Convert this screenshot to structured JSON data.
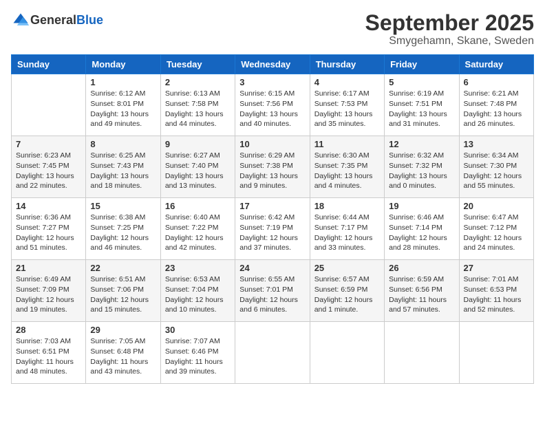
{
  "header": {
    "logo_general": "General",
    "logo_blue": "Blue",
    "month": "September 2025",
    "location": "Smygehamn, Skane, Sweden"
  },
  "weekdays": [
    "Sunday",
    "Monday",
    "Tuesday",
    "Wednesday",
    "Thursday",
    "Friday",
    "Saturday"
  ],
  "weeks": [
    [
      {
        "day": "",
        "info": ""
      },
      {
        "day": "1",
        "info": "Sunrise: 6:12 AM\nSunset: 8:01 PM\nDaylight: 13 hours\nand 49 minutes."
      },
      {
        "day": "2",
        "info": "Sunrise: 6:13 AM\nSunset: 7:58 PM\nDaylight: 13 hours\nand 44 minutes."
      },
      {
        "day": "3",
        "info": "Sunrise: 6:15 AM\nSunset: 7:56 PM\nDaylight: 13 hours\nand 40 minutes."
      },
      {
        "day": "4",
        "info": "Sunrise: 6:17 AM\nSunset: 7:53 PM\nDaylight: 13 hours\nand 35 minutes."
      },
      {
        "day": "5",
        "info": "Sunrise: 6:19 AM\nSunset: 7:51 PM\nDaylight: 13 hours\nand 31 minutes."
      },
      {
        "day": "6",
        "info": "Sunrise: 6:21 AM\nSunset: 7:48 PM\nDaylight: 13 hours\nand 26 minutes."
      }
    ],
    [
      {
        "day": "7",
        "info": "Sunrise: 6:23 AM\nSunset: 7:45 PM\nDaylight: 13 hours\nand 22 minutes."
      },
      {
        "day": "8",
        "info": "Sunrise: 6:25 AM\nSunset: 7:43 PM\nDaylight: 13 hours\nand 18 minutes."
      },
      {
        "day": "9",
        "info": "Sunrise: 6:27 AM\nSunset: 7:40 PM\nDaylight: 13 hours\nand 13 minutes."
      },
      {
        "day": "10",
        "info": "Sunrise: 6:29 AM\nSunset: 7:38 PM\nDaylight: 13 hours\nand 9 minutes."
      },
      {
        "day": "11",
        "info": "Sunrise: 6:30 AM\nSunset: 7:35 PM\nDaylight: 13 hours\nand 4 minutes."
      },
      {
        "day": "12",
        "info": "Sunrise: 6:32 AM\nSunset: 7:32 PM\nDaylight: 13 hours\nand 0 minutes."
      },
      {
        "day": "13",
        "info": "Sunrise: 6:34 AM\nSunset: 7:30 PM\nDaylight: 12 hours\nand 55 minutes."
      }
    ],
    [
      {
        "day": "14",
        "info": "Sunrise: 6:36 AM\nSunset: 7:27 PM\nDaylight: 12 hours\nand 51 minutes."
      },
      {
        "day": "15",
        "info": "Sunrise: 6:38 AM\nSunset: 7:25 PM\nDaylight: 12 hours\nand 46 minutes."
      },
      {
        "day": "16",
        "info": "Sunrise: 6:40 AM\nSunset: 7:22 PM\nDaylight: 12 hours\nand 42 minutes."
      },
      {
        "day": "17",
        "info": "Sunrise: 6:42 AM\nSunset: 7:19 PM\nDaylight: 12 hours\nand 37 minutes."
      },
      {
        "day": "18",
        "info": "Sunrise: 6:44 AM\nSunset: 7:17 PM\nDaylight: 12 hours\nand 33 minutes."
      },
      {
        "day": "19",
        "info": "Sunrise: 6:46 AM\nSunset: 7:14 PM\nDaylight: 12 hours\nand 28 minutes."
      },
      {
        "day": "20",
        "info": "Sunrise: 6:47 AM\nSunset: 7:12 PM\nDaylight: 12 hours\nand 24 minutes."
      }
    ],
    [
      {
        "day": "21",
        "info": "Sunrise: 6:49 AM\nSunset: 7:09 PM\nDaylight: 12 hours\nand 19 minutes."
      },
      {
        "day": "22",
        "info": "Sunrise: 6:51 AM\nSunset: 7:06 PM\nDaylight: 12 hours\nand 15 minutes."
      },
      {
        "day": "23",
        "info": "Sunrise: 6:53 AM\nSunset: 7:04 PM\nDaylight: 12 hours\nand 10 minutes."
      },
      {
        "day": "24",
        "info": "Sunrise: 6:55 AM\nSunset: 7:01 PM\nDaylight: 12 hours\nand 6 minutes."
      },
      {
        "day": "25",
        "info": "Sunrise: 6:57 AM\nSunset: 6:59 PM\nDaylight: 12 hours\nand 1 minute."
      },
      {
        "day": "26",
        "info": "Sunrise: 6:59 AM\nSunset: 6:56 PM\nDaylight: 11 hours\nand 57 minutes."
      },
      {
        "day": "27",
        "info": "Sunrise: 7:01 AM\nSunset: 6:53 PM\nDaylight: 11 hours\nand 52 minutes."
      }
    ],
    [
      {
        "day": "28",
        "info": "Sunrise: 7:03 AM\nSunset: 6:51 PM\nDaylight: 11 hours\nand 48 minutes."
      },
      {
        "day": "29",
        "info": "Sunrise: 7:05 AM\nSunset: 6:48 PM\nDaylight: 11 hours\nand 43 minutes."
      },
      {
        "day": "30",
        "info": "Sunrise: 7:07 AM\nSunset: 6:46 PM\nDaylight: 11 hours\nand 39 minutes."
      },
      {
        "day": "",
        "info": ""
      },
      {
        "day": "",
        "info": ""
      },
      {
        "day": "",
        "info": ""
      },
      {
        "day": "",
        "info": ""
      }
    ]
  ]
}
